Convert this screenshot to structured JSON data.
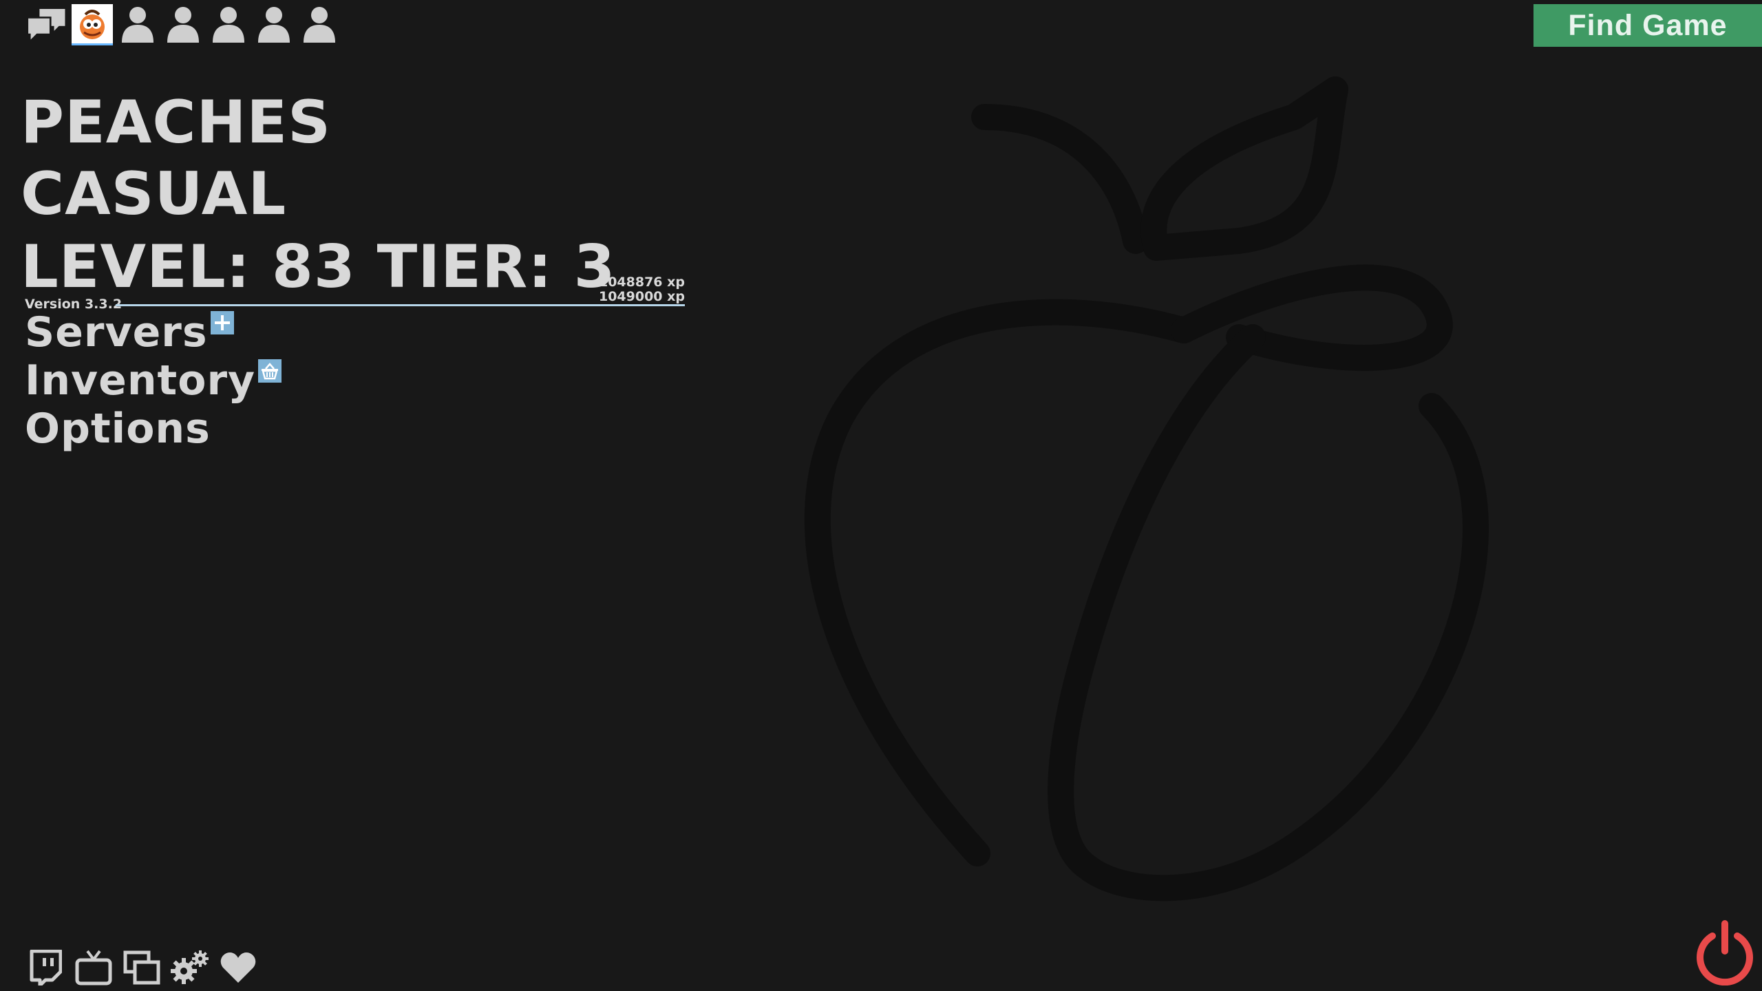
{
  "header": {
    "find_game_label": "Find Game",
    "icons": [
      "chat-icon",
      "avatar",
      "player-slot-icon",
      "player-slot-icon",
      "player-slot-icon",
      "player-slot-icon",
      "player-slot-icon"
    ]
  },
  "profile": {
    "name": "PEACHES",
    "mode": "CASUAL",
    "level_tier": "LEVEL: 83 TIER: 3",
    "xp_current": "1048876 xp",
    "xp_needed": "1049000 xp",
    "xp_progress": 0.99988,
    "version": "Version 3.3.2"
  },
  "menu": {
    "items": [
      {
        "label": "Servers",
        "badge": "plus-badge-icon"
      },
      {
        "label": "Inventory",
        "badge": "basket-badge-icon"
      },
      {
        "label": "Options"
      }
    ]
  },
  "footer": {
    "icons": [
      "twitch-icon",
      "tv-icon",
      "windows-icon",
      "settings-icon",
      "heart-icon"
    ],
    "power_icon": "power-icon"
  },
  "colors": {
    "background": "#181818",
    "text": "#d9d9d9",
    "find_game": "#3f9a64",
    "power": "#e84a4a",
    "badge": "#7fb3d6"
  }
}
